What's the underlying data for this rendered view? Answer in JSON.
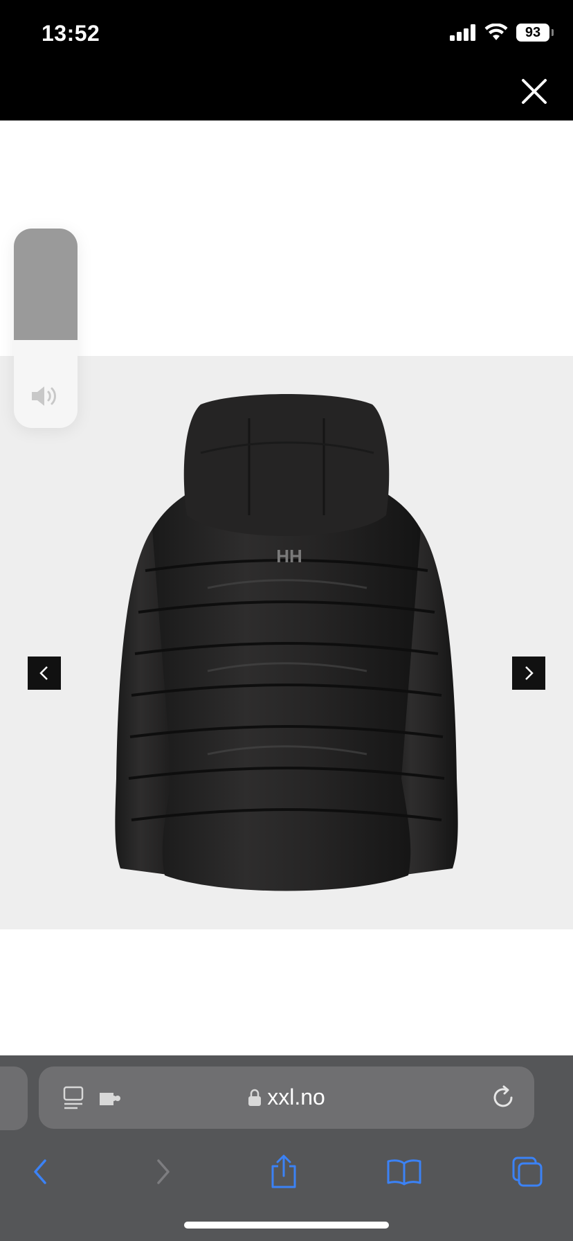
{
  "status_bar": {
    "time": "13:52",
    "battery": "93"
  },
  "volume": {
    "level": 0.56
  },
  "address_bar": {
    "domain": "xxl.no"
  },
  "product_image": {
    "logo_text": "HH"
  },
  "colors": {
    "accent": "#3b82f6",
    "lightbox": "#000000",
    "stage": "#eeeeee",
    "safari_chrome": "#555658"
  }
}
